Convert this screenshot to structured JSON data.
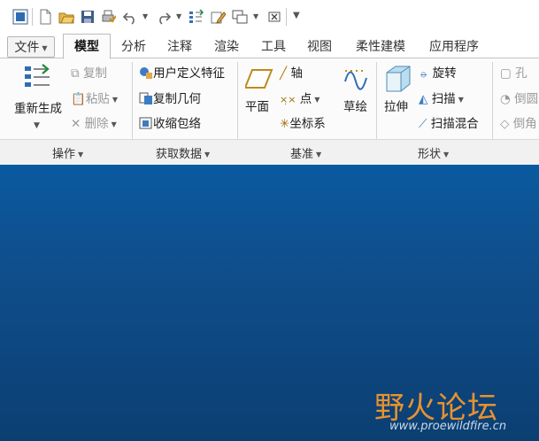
{
  "quick_access": {
    "icons": [
      "window-icon",
      "new-file-icon",
      "open-folder-icon",
      "save-icon",
      "print-icon",
      "undo-icon",
      "redo-icon",
      "regenerate-icon",
      "edit-icon",
      "windows-icon",
      "close-window-icon",
      "customize-icon"
    ]
  },
  "tabs": [
    {
      "label": "文件"
    },
    {
      "label": "模型"
    },
    {
      "label": "分析"
    },
    {
      "label": "注释"
    },
    {
      "label": "渲染"
    },
    {
      "label": "工具"
    },
    {
      "label": "视图"
    },
    {
      "label": "柔性建模"
    },
    {
      "label": "应用程序"
    }
  ],
  "active_tab": "模型",
  "ribbon": {
    "operations": {
      "regenerate_label": "重新生成",
      "copy_label": "复制",
      "paste_label": "粘贴",
      "delete_label": "删除",
      "group_label": "操作"
    },
    "get_data": {
      "udf_label": "用户定义特征",
      "copy_geometry_label": "复制几何",
      "shrinkwrap_label": "收缩包络",
      "group_label": "获取数据"
    },
    "datum": {
      "plane_label": "平面",
      "axis_label": "轴",
      "point_label": "点",
      "csys_label": "坐标系",
      "sketch_label": "草绘",
      "group_label": "基准"
    },
    "shapes": {
      "extrude_label": "拉伸",
      "revolve_label": "旋转",
      "sweep_label": "扫描",
      "swept_blend_label": "扫描混合",
      "group_label": "形状"
    },
    "engineering": {
      "hole_label": "孔",
      "round_label": "倒圆",
      "chamfer_label": "倒角"
    }
  },
  "watermark": {
    "text": "野火论坛",
    "url": "www.proewildfire.cn"
  },
  "colors": {
    "canvas_top": "#0a5aa0",
    "canvas_bottom": "#0b3f72",
    "watermark": "#e9922f"
  }
}
